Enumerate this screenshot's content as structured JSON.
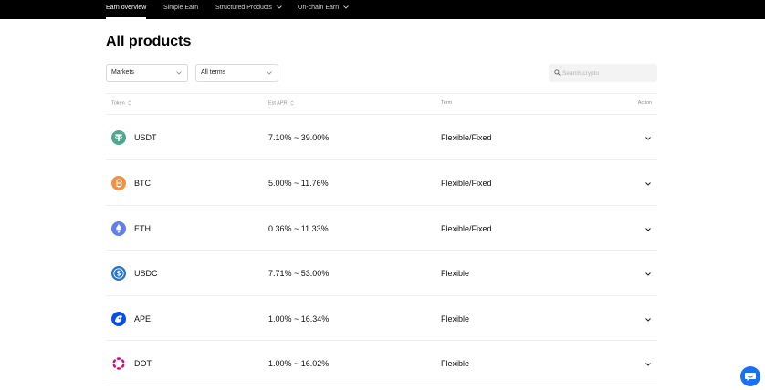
{
  "nav": {
    "items": [
      {
        "label": "Earn overview",
        "active": true,
        "dropdown": false
      },
      {
        "label": "Simple Earn",
        "active": false,
        "dropdown": false
      },
      {
        "label": "Structured Products",
        "active": false,
        "dropdown": true
      },
      {
        "label": "On-chain Earn",
        "active": false,
        "dropdown": true
      }
    ]
  },
  "page_title": "All products",
  "filters": {
    "market": {
      "value": "Markets"
    },
    "term": {
      "value": "All terms"
    },
    "search": {
      "placeholder": "Search crypto",
      "value": ""
    }
  },
  "table": {
    "headers": {
      "token": "Token",
      "apr": "Est APR",
      "term": "Term",
      "action": "Action"
    },
    "rows": [
      {
        "token": "USDT",
        "apr": "7.10% ~ 39.00%",
        "term": "Flexible/Fixed",
        "icon": "usdt-icon",
        "color": "#50a68f"
      },
      {
        "token": "BTC",
        "apr": "5.00% ~ 11.76%",
        "term": "Flexible/Fixed",
        "icon": "btc-icon",
        "color": "#f09242"
      },
      {
        "token": "ETH",
        "apr": "0.36% ~ 11.33%",
        "term": "Flexible/Fixed",
        "icon": "eth-icon",
        "color": "#627eea"
      },
      {
        "token": "USDC",
        "apr": "7.71% ~ 53.00%",
        "term": "Flexible",
        "icon": "usdc-icon",
        "color": "#2775ca"
      },
      {
        "token": "APE",
        "apr": "1.00% ~ 16.34%",
        "term": "Flexible",
        "icon": "ape-icon",
        "color": "#0b4fe0"
      },
      {
        "token": "DOT",
        "apr": "1.00% ~ 16.02%",
        "term": "Flexible",
        "icon": "dot-icon",
        "color": "#e6007a"
      }
    ]
  },
  "chat": {
    "icon": "chat-icon",
    "color": "#1b6ff5"
  }
}
